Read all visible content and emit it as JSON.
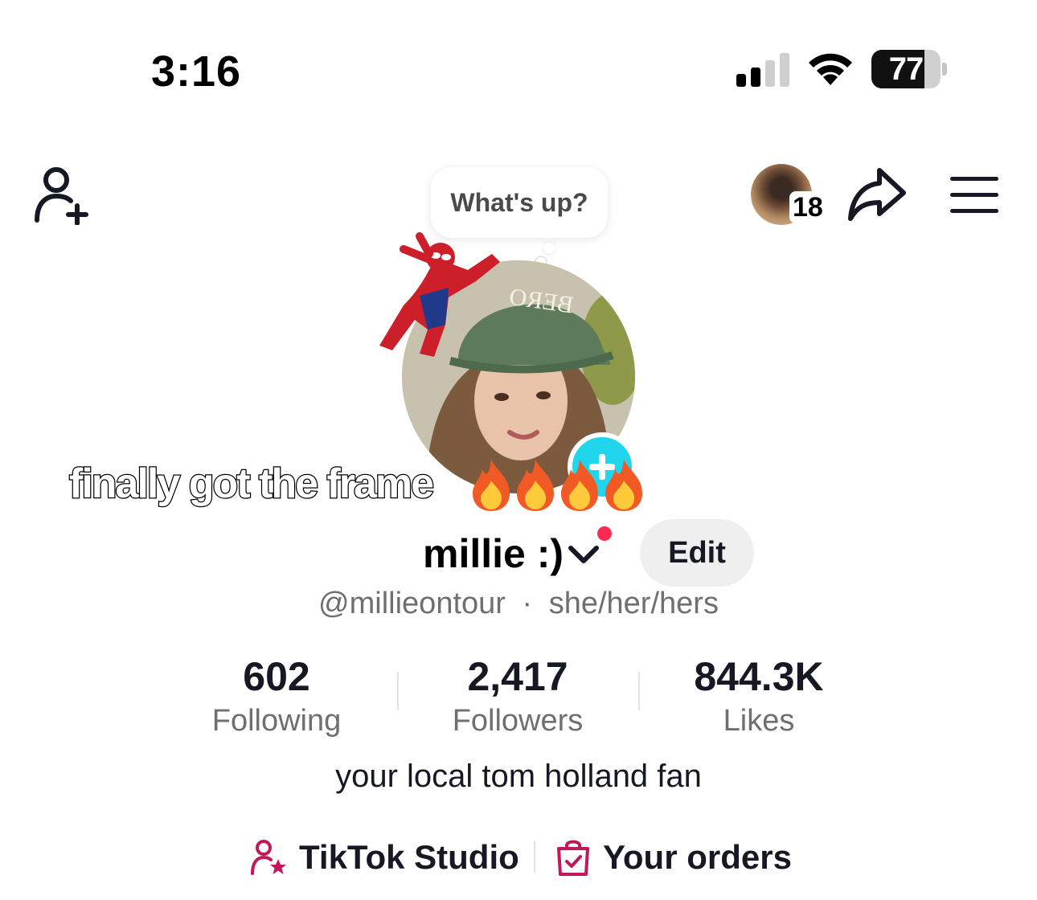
{
  "status_bar": {
    "time": "3:16",
    "battery_level": "77",
    "battery_fraction": 0.77,
    "signal_bars_active": 2,
    "signal_bars_total": 4
  },
  "nav": {
    "story_count": "18"
  },
  "bubble": {
    "text": "What's up?"
  },
  "caption": {
    "text": "finally got the frame",
    "emoji": [
      "🔥",
      "🔥",
      "🔥",
      "🔥"
    ]
  },
  "profile": {
    "display_name": "millie :)",
    "edit_label": "Edit",
    "handle": "@millieontour",
    "separator": "·",
    "pronouns": "she/her/hers",
    "bio": "your local tom holland fan"
  },
  "stats": [
    {
      "value": "602",
      "label": "Following"
    },
    {
      "value": "2,417",
      "label": "Followers"
    },
    {
      "value": "844.3K",
      "label": "Likes"
    }
  ],
  "links": {
    "studio_label": "TikTok Studio",
    "orders_label": "Your orders"
  },
  "colors": {
    "accent_red": "#fe2c55",
    "plus_badge": "#20d5ec",
    "link_icon": "#c2185b"
  }
}
